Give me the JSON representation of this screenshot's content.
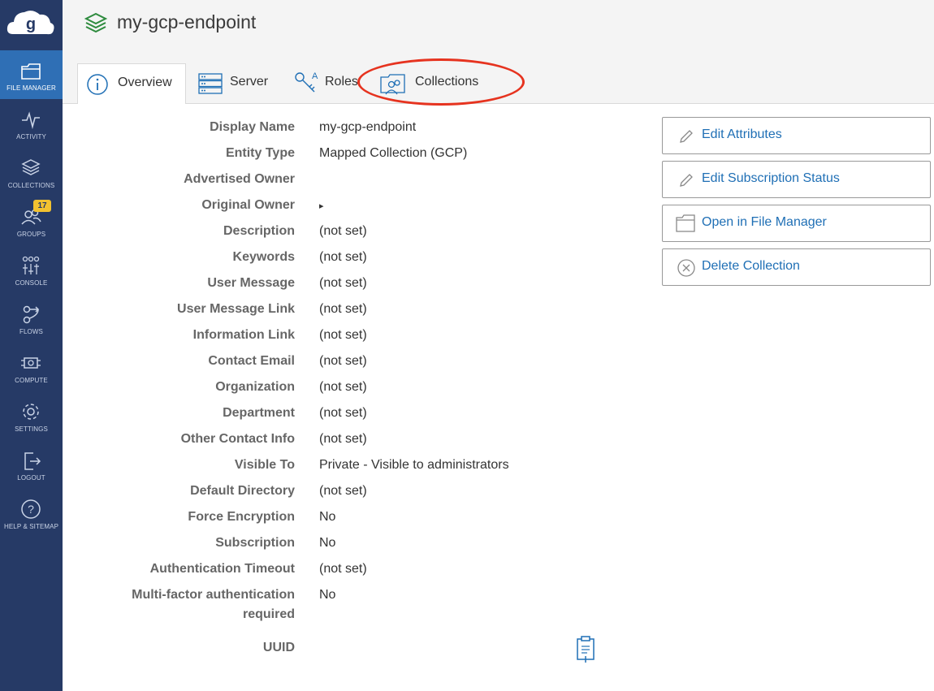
{
  "sidebar": {
    "logo": "globus-logo",
    "items": [
      {
        "label": "FILE MANAGER",
        "icon": "folder-icon",
        "active": true
      },
      {
        "label": "ACTIVITY",
        "icon": "activity-icon"
      },
      {
        "label": "COLLECTIONS",
        "icon": "collections-icon"
      },
      {
        "label": "GROUPS",
        "icon": "groups-icon",
        "badge": "17"
      },
      {
        "label": "CONSOLE",
        "icon": "console-icon"
      },
      {
        "label": "FLOWS",
        "icon": "flows-icon"
      },
      {
        "label": "COMPUTE",
        "icon": "compute-icon"
      },
      {
        "label": "SETTINGS",
        "icon": "gear-icon"
      },
      {
        "label": "LOGOUT",
        "icon": "logout-icon"
      },
      {
        "label": "HELP & SITEMAP",
        "icon": "help-icon"
      }
    ]
  },
  "header": {
    "title": "my-gcp-endpoint",
    "tabs": [
      {
        "label": "Overview",
        "active": true
      },
      {
        "label": "Server"
      },
      {
        "label": "Roles"
      },
      {
        "label": "Collections"
      }
    ]
  },
  "details": {
    "rows": [
      {
        "label": "Display Name",
        "value": "my-gcp-endpoint"
      },
      {
        "label": "Entity Type",
        "value": "Mapped Collection (GCP)"
      },
      {
        "label": "Advertised Owner",
        "value": ""
      },
      {
        "label": "Original Owner",
        "value": "▸"
      },
      {
        "label": "Description",
        "value": "(not set)"
      },
      {
        "label": "Keywords",
        "value": "(not set)"
      },
      {
        "label": "User Message",
        "value": "(not set)"
      },
      {
        "label": "User Message Link",
        "value": "(not set)"
      },
      {
        "label": "Information Link",
        "value": "(not set)"
      },
      {
        "label": "Contact Email",
        "value": "(not set)"
      },
      {
        "label": "Organization",
        "value": "(not set)"
      },
      {
        "label": "Department",
        "value": "(not set)"
      },
      {
        "label": "Other Contact Info",
        "value": "(not set)"
      },
      {
        "label": "Visible To",
        "value": "Private - Visible to administrators"
      },
      {
        "label": "Default Directory",
        "value": "(not set)"
      },
      {
        "label": "Force Encryption",
        "value": "No"
      },
      {
        "label": "Subscription",
        "value": "No"
      },
      {
        "label": "Authentication Timeout",
        "value": "(not set)"
      },
      {
        "label": "Multi-factor authentication",
        "label2": "required",
        "value": "No"
      },
      {
        "label": "UUID",
        "value": ""
      }
    ]
  },
  "actions": [
    {
      "label": "Edit Attributes",
      "icon": "pencil-icon"
    },
    {
      "label": "Edit Subscription Status",
      "icon": "pencil-icon"
    },
    {
      "label": "Open in File Manager",
      "icon": "folder-icon"
    },
    {
      "label": "Delete Collection",
      "icon": "circle-x-icon"
    }
  ],
  "colors": {
    "sidebar": "#263a66",
    "sidebar_active": "#2f6fb5",
    "link": "#1f6fb5",
    "badge": "#f2c230",
    "annotation": "#e6331f",
    "title_icon": "#2e8b3e"
  }
}
